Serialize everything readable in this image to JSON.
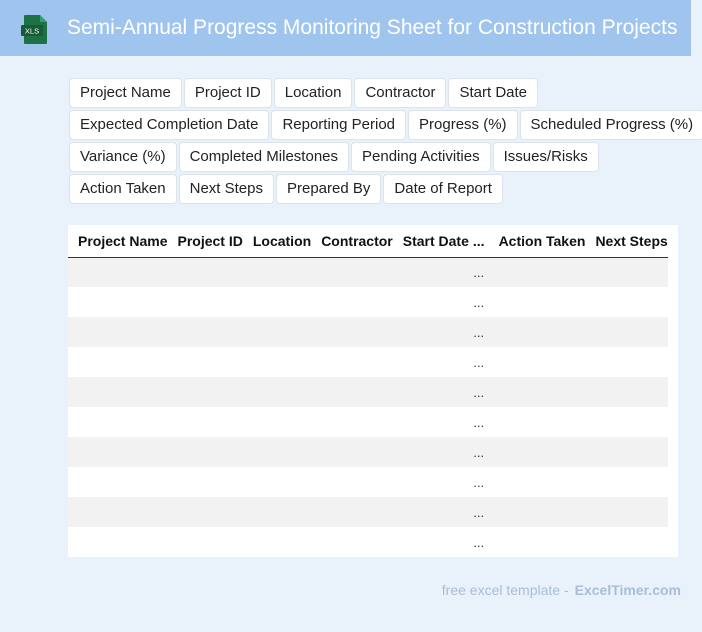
{
  "header": {
    "icon_label": "XLS",
    "title": "Semi-Annual Progress Monitoring Sheet for Construction Projects"
  },
  "tags": [
    [
      "Project Name",
      "Project ID",
      "Location",
      "Contractor",
      "Start Date"
    ],
    [
      "Expected Completion Date",
      "Reporting Period",
      "Progress (%)",
      "Scheduled Progress (%)"
    ],
    [
      "Variance (%)",
      "Completed Milestones",
      "Pending Activities",
      "Issues/Risks"
    ],
    [
      "Action Taken",
      "Next Steps",
      "Prepared By",
      "Date of Report"
    ]
  ],
  "table": {
    "columns": [
      "Project Name",
      "Project ID",
      "Location",
      "Contractor",
      "Start Date",
      "...",
      "Action Taken",
      "Next Steps"
    ],
    "rows": [
      [
        "",
        "",
        "",
        "",
        "",
        "...",
        "",
        ""
      ],
      [
        "",
        "",
        "",
        "",
        "",
        "...",
        "",
        ""
      ],
      [
        "",
        "",
        "",
        "",
        "",
        "...",
        "",
        ""
      ],
      [
        "",
        "",
        "",
        "",
        "",
        "...",
        "",
        ""
      ],
      [
        "",
        "",
        "",
        "",
        "",
        "...",
        "",
        ""
      ],
      [
        "",
        "",
        "",
        "",
        "",
        "...",
        "",
        ""
      ],
      [
        "",
        "",
        "",
        "",
        "",
        "...",
        "",
        ""
      ],
      [
        "",
        "",
        "",
        "",
        "",
        "...",
        "",
        ""
      ],
      [
        "",
        "",
        "",
        "",
        "",
        "...",
        "",
        ""
      ],
      [
        "",
        "",
        "",
        "",
        "",
        "...",
        "",
        ""
      ]
    ]
  },
  "footer": {
    "text": "free excel template -",
    "brand": "ExcelTimer.com"
  },
  "colors": {
    "header_bg": "#9fc5ef",
    "page_bg": "#e9f1fb",
    "icon_green": "#1e7145",
    "row_stripe": "#f2f2f2"
  }
}
